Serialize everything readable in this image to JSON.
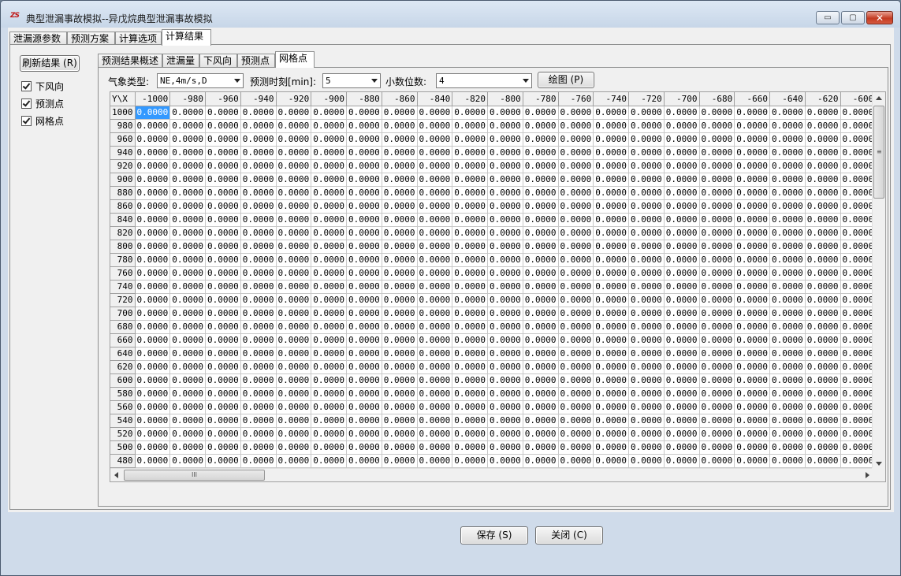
{
  "window": {
    "app_icon_text": "ZS",
    "title": "典型泄漏事故模拟--异戊烷典型泄漏事故模拟",
    "minimize": "▭",
    "maximize": "▢",
    "close": "✕"
  },
  "outer_tabs": [
    "泄漏源参数",
    "预测方案",
    "计算选项",
    "计算结果"
  ],
  "outer_tab_active": "计算结果",
  "left_panel": {
    "refresh_label": "刷新结果 (R)",
    "checkboxes": [
      {
        "label": "下风向",
        "checked": true
      },
      {
        "label": "预测点",
        "checked": true
      },
      {
        "label": "网格点",
        "checked": true
      }
    ]
  },
  "inner_tabs": [
    "预测结果概述",
    "泄漏量",
    "下风向",
    "预测点",
    "网格点"
  ],
  "inner_tab_active": "网格点",
  "controls": {
    "weather_label": "气象类型:",
    "weather_value": "NE,4m/s,D",
    "time_label": "预测时刻[min]:",
    "time_value": "5",
    "decimals_label": "小数位数:",
    "decimals_value": "4",
    "draw_label": "绘图 (P)"
  },
  "grid": {
    "corner": "Y\\X",
    "x_values": [
      "-1000",
      "-980",
      "-960",
      "-940",
      "-920",
      "-900",
      "-880",
      "-860",
      "-840",
      "-820",
      "-800",
      "-780",
      "-760",
      "-740",
      "-720",
      "-700",
      "-680",
      "-660",
      "-640",
      "-620",
      "-600"
    ],
    "y_values": [
      "1000",
      "980",
      "960",
      "940",
      "920",
      "900",
      "880",
      "860",
      "840",
      "820",
      "800",
      "780",
      "760",
      "740",
      "720",
      "700",
      "680",
      "660",
      "640",
      "620",
      "600",
      "580",
      "560",
      "540",
      "520",
      "500",
      "480"
    ],
    "cell_value": "0.0000",
    "selected_cell": {
      "row": 0,
      "col": 0
    }
  },
  "scrollbars": {
    "v_grip": "≡",
    "h_grip": "III"
  },
  "footer": {
    "save_label": "保存 (S)",
    "close_label": "关闭 (C)"
  },
  "colors": {
    "selection": "#3399ff",
    "close_button": "#c43b23",
    "window_frame": "#cfdbea"
  }
}
